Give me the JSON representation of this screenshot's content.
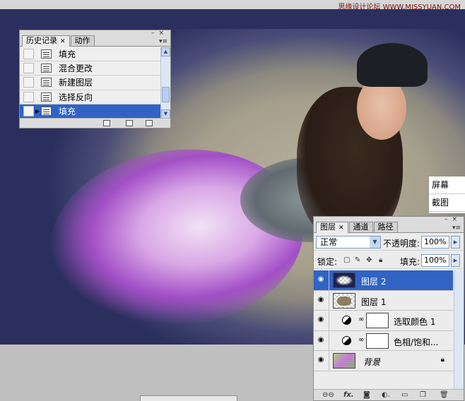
{
  "watermark": "思缘设计论坛 WWW.MISSYUAN.COM",
  "history_panel": {
    "tabs": [
      {
        "label": "历史记录",
        "active": true
      },
      {
        "label": "动作",
        "active": false
      }
    ],
    "items": [
      {
        "label": "填充",
        "selected": false
      },
      {
        "label": "混合更改",
        "selected": false
      },
      {
        "label": "新建图层",
        "selected": false
      },
      {
        "label": "选择反向",
        "selected": false
      },
      {
        "label": "填充",
        "selected": true
      }
    ]
  },
  "layers_panel": {
    "tabs": [
      {
        "label": "图层",
        "active": true
      },
      {
        "label": "通道",
        "active": false
      },
      {
        "label": "路径",
        "active": false
      }
    ],
    "blend_mode": "正常",
    "opacity_label": "不透明度:",
    "opacity_value": "100%",
    "lock_label": "锁定:",
    "fill_label": "填充:",
    "fill_value": "100%",
    "layers": [
      {
        "name": "图层 2",
        "selected": true,
        "kind": "pixel"
      },
      {
        "name": "图层 1",
        "selected": false,
        "kind": "pixel"
      },
      {
        "name": "选取颜色 1",
        "selected": false,
        "kind": "adjustment"
      },
      {
        "name": "色相/饱和...",
        "selected": false,
        "kind": "adjustment"
      },
      {
        "name": "背景",
        "selected": false,
        "kind": "background"
      }
    ]
  },
  "side_panel": {
    "items": [
      "屏幕",
      "截图"
    ]
  },
  "colors": {
    "selection": "#3163c5",
    "canvas_bg": "#2b2f5d",
    "panel_bg": "#ececec"
  }
}
